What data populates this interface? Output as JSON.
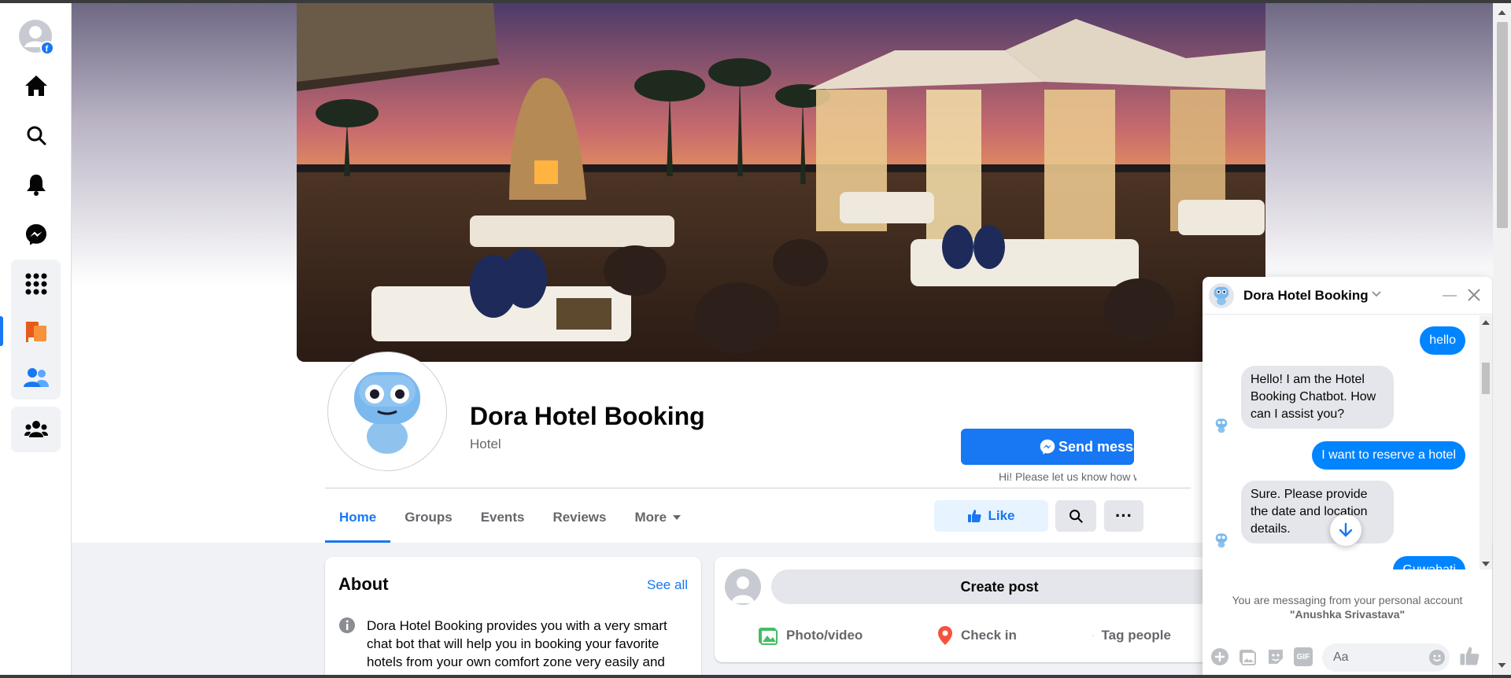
{
  "page": {
    "title": "Dora Hotel Booking",
    "category": "Hotel",
    "send_message": "Send message",
    "hint": "Hi! Please let us know how we can help."
  },
  "tabs": [
    {
      "label": "Home",
      "active": true
    },
    {
      "label": "Groups"
    },
    {
      "label": "Events"
    },
    {
      "label": "Reviews"
    },
    {
      "label": "More"
    }
  ],
  "actions": {
    "like": "Like"
  },
  "about": {
    "heading": "About",
    "see_all": "See all",
    "description": "Dora Hotel Booking provides you with a very smart chat bot that will help you in booking your favorite hotels from your own comfort zone very easily and quickly!!"
  },
  "create_post": {
    "label": "Create post",
    "photo": "Photo/video",
    "checkin": "Check in",
    "tag": "Tag people"
  },
  "chat": {
    "name": "Dora Hotel Booking",
    "messages": [
      {
        "from": "user",
        "text": "hello"
      },
      {
        "from": "bot",
        "text": "Hello! I am the Hotel Booking Chatbot. How can I assist you?"
      },
      {
        "from": "user",
        "text": "I want to reserve a hotel"
      },
      {
        "from": "bot",
        "text": "Sure. Please provide the date and location details."
      },
      {
        "from": "user",
        "text": "Guwahati"
      }
    ],
    "note_line1": "You are messaging from your personal account",
    "note_account": "\"Anushka Srivastava\"",
    "input_placeholder": "Aa",
    "gif": "GIF"
  },
  "colors": {
    "accent": "#1877f2",
    "bubble_out": "#0084ff",
    "bubble_in": "#e4e6eb"
  }
}
